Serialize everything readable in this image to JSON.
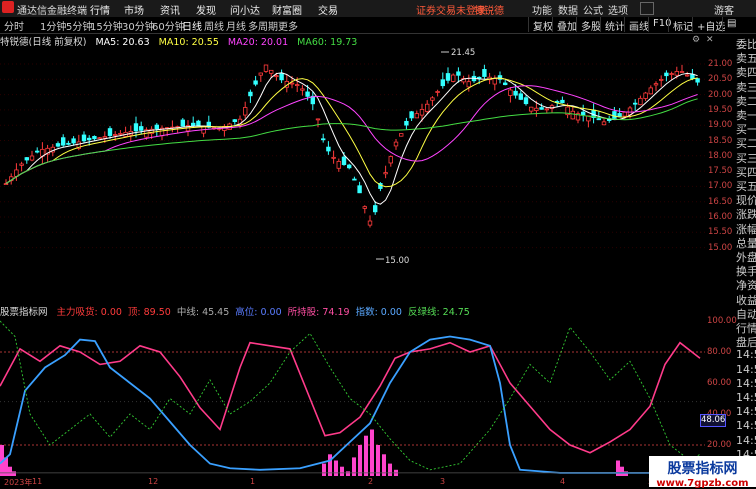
{
  "titlebar": {
    "app_title": "通达信金融终端",
    "menus": [
      "行情",
      "市场",
      "资讯",
      "发现",
      "问小达",
      "财富圈",
      "交易"
    ],
    "notice": "证券交易未登录",
    "user": "特锐德",
    "actions": [
      "功能",
      "数据",
      "公式",
      "选项"
    ],
    "guest": "游客"
  },
  "toolbar": {
    "periods": [
      "分时",
      "1分钟",
      "5分钟",
      "15分钟",
      "30分钟",
      "60分钟",
      "日线",
      "周线",
      "月线",
      "多周期",
      "更多"
    ],
    "active_period": "日线",
    "right_buttons": [
      "复权",
      "叠加",
      "多股",
      "统计",
      "画线",
      "F10",
      "标记",
      "自选"
    ]
  },
  "info": {
    "stock_title": "特锐德(日线 前复权)",
    "ma5": "MA5: 20.63",
    "ma10": "MA10: 20.55",
    "ma20": "MA20: 20.01",
    "ma60": "MA60: 19.73"
  },
  "price_axis": [
    "21.00",
    "20.50",
    "20.00",
    "19.50",
    "19.00",
    "18.50",
    "18.00",
    "17.50",
    "17.00",
    "16.50",
    "16.00",
    "15.50",
    "15.00"
  ],
  "price_annotations": {
    "high": "21.45",
    "low": "15.00"
  },
  "indicator": {
    "name": "股票指标网",
    "items": [
      {
        "label": "主力吸货: 0.00",
        "color": "#ff3b3b"
      },
      {
        "label": "顶: 89.50",
        "color": "#ff3b3b"
      },
      {
        "label": "中线: 45.45",
        "color": "#aaaaaa"
      },
      {
        "label": "高位: 0.00",
        "color": "#5a7cff"
      },
      {
        "label": "所持股: 74.19",
        "color": "#ff4fa3"
      },
      {
        "label": "指数: 0.00",
        "color": "#5aa8ff"
      },
      {
        "label": "反绿线: 24.75",
        "color": "#55dd55"
      }
    ],
    "axis": [
      "100.00",
      "80.00",
      "60.00",
      "40.00",
      "20.00"
    ],
    "current_value": "48.06"
  },
  "time_axis": [
    "2023年",
    "11",
    "12",
    "1",
    "2",
    "3",
    "4",
    "5"
  ],
  "right_panel": [
    "委比",
    "卖五",
    "卖四",
    "卖三",
    "卖二",
    "卖一",
    "买一",
    "买二",
    "买三",
    "买四",
    "买五",
    "现价",
    "涨跌",
    "涨幅",
    "总量",
    "外盘",
    "换手",
    "净资",
    "收益",
    "自动",
    "行情",
    "盘后",
    "14:5",
    "14:5",
    "14:5",
    "14:5",
    "14:5",
    "14:5",
    "14:5",
    "14:5"
  ],
  "watermark": {
    "line1": "股票指标网",
    "line2": "www.7gpzb.com"
  },
  "colors": {
    "up": "#ff3b3b",
    "down": "#33ffff",
    "ma5": "#ffffff",
    "ma10": "#ffff44",
    "ma20": "#ff44ff",
    "ma60": "#44dd44",
    "main_line": "#ff3b8a",
    "blue_line": "#3aa0ff"
  }
}
